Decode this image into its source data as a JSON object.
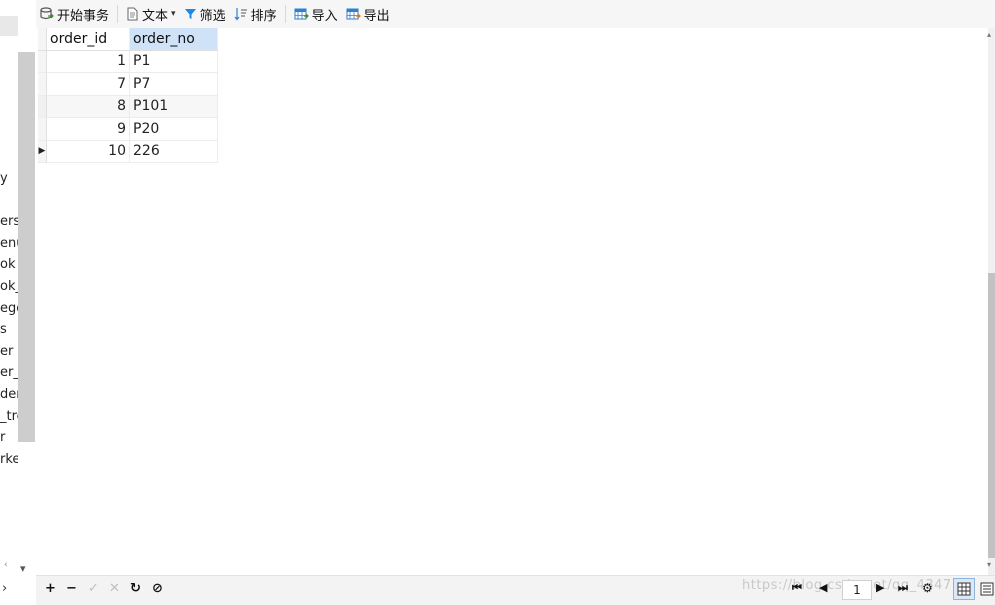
{
  "toolbar": {
    "begin_transaction": "开始事务",
    "text": "文本",
    "filter": "筛选",
    "sort": "排序",
    "import": "导入",
    "export": "导出"
  },
  "left_pane": {
    "items": [
      "y",
      "ersi",
      "enu",
      "ok",
      "ok_",
      "ego",
      "s",
      "er",
      "er_",
      "der",
      "_tre",
      "r",
      "rke"
    ]
  },
  "grid": {
    "columns": [
      "order_id",
      "order_no"
    ],
    "rows": [
      {
        "order_id": "1",
        "order_no": "P1"
      },
      {
        "order_id": "7",
        "order_no": "P7"
      },
      {
        "order_id": "8",
        "order_no": "P101"
      },
      {
        "order_id": "9",
        "order_no": "P20"
      },
      {
        "order_id": "10",
        "order_no": "226"
      }
    ],
    "current_row_indicator": "▶"
  },
  "bottom_bar": {
    "add": "+",
    "remove": "−",
    "apply": "✓",
    "discard": "✕",
    "refresh": "↻",
    "stop": "⊘",
    "page": "1",
    "watermark": "https://blog.csdn.net/qq_4347"
  },
  "icons": {
    "transaction": "database-transaction-icon",
    "text": "document-icon",
    "filter": "funnel-icon",
    "sort": "sort-icon",
    "import": "table-import-icon",
    "export": "table-export-icon"
  },
  "colors": {
    "selected_header": "#cfe2f7",
    "filter_icon": "#1e88e5",
    "import_icon": "#2f80d1"
  }
}
